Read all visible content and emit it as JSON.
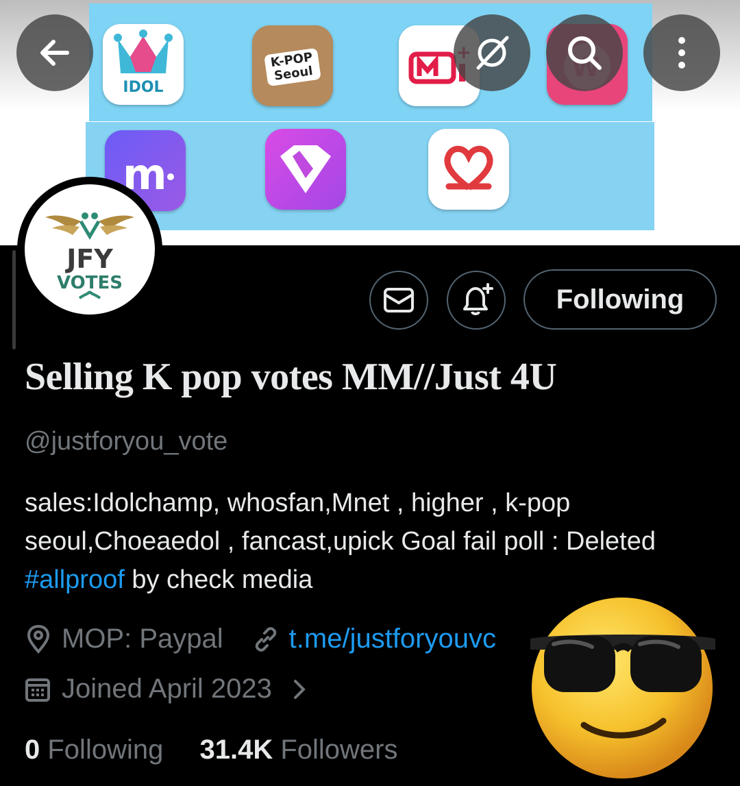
{
  "banner": {
    "apps_row1": [
      {
        "name": "idol-champ",
        "label": "IDOL"
      },
      {
        "name": "k-pop-seoul",
        "label": "K-POP Seoul"
      },
      {
        "name": "mnet-plus",
        "label": ""
      },
      {
        "name": "whosfan",
        "label": ""
      }
    ],
    "apps_row2": [
      {
        "name": "choeaedol",
        "label": ""
      },
      {
        "name": "upick",
        "label": ""
      },
      {
        "name": "fancast",
        "label": ""
      }
    ]
  },
  "topbar": {
    "back": "back-icon",
    "grok": "grok-icon",
    "search": "search-icon",
    "more": "more-icon"
  },
  "avatar": {
    "logo_line1": "JFY",
    "logo_line2": "VOTES"
  },
  "actions": {
    "message_icon": "mail-icon",
    "notify_icon": "bell-plus-icon",
    "follow_label": "Following"
  },
  "profile": {
    "display_name": "Selling K pop votes MM//Just 4U",
    "handle": "@justforyou_vote",
    "bio_before": "sales:Idolchamp, whosfan,Mnet , higher , k-pop seoul,Choeaedol , fancast,upick  Goal fail poll : Deleted ",
    "bio_hashtag": "#allproof",
    "bio_after": " by check media",
    "location": "MOP: Paypal",
    "website": "t.me/justforyouvc",
    "joined": "Joined April 2023"
  },
  "stats": {
    "following_count": "0",
    "following_label": "Following",
    "followers_count": "31.4K",
    "followers_label": "Followers"
  },
  "colors": {
    "link": "#1d9bf0",
    "muted": "#71767b",
    "text": "#e7e9ea",
    "border": "#536471"
  }
}
